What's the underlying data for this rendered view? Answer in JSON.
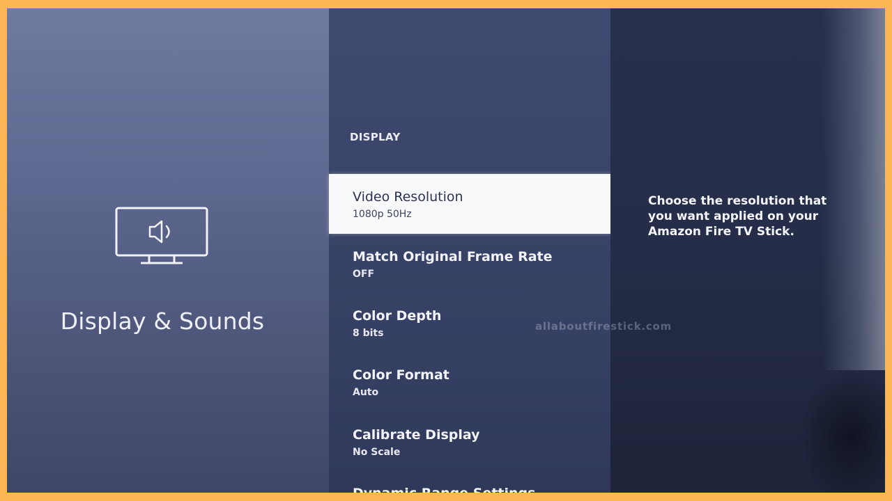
{
  "section": {
    "title": "Display & Sounds",
    "icon": "tv-speaker-icon"
  },
  "menu": {
    "header": "DISPLAY",
    "items": [
      {
        "label": "Video Resolution",
        "value": "1080p 50Hz",
        "selected": true
      },
      {
        "label": "Match Original Frame Rate",
        "value": "OFF",
        "selected": false
      },
      {
        "label": "Color Depth",
        "value": "8 bits",
        "selected": false
      },
      {
        "label": "Color Format",
        "value": "Auto",
        "selected": false
      },
      {
        "label": "Calibrate Display",
        "value": "No Scale",
        "selected": false
      },
      {
        "label": "Dynamic Range Settings",
        "value": "",
        "selected": false
      }
    ]
  },
  "description": "Choose the resolution that you want applied on your Amazon Fire TV Stick.",
  "watermark": "allaboutfirestick.com",
  "colors": {
    "border": "#fbb755",
    "selected_bg": "#f8f9fb",
    "selected_text": "#2b3350",
    "text": "#f2f4fa"
  }
}
